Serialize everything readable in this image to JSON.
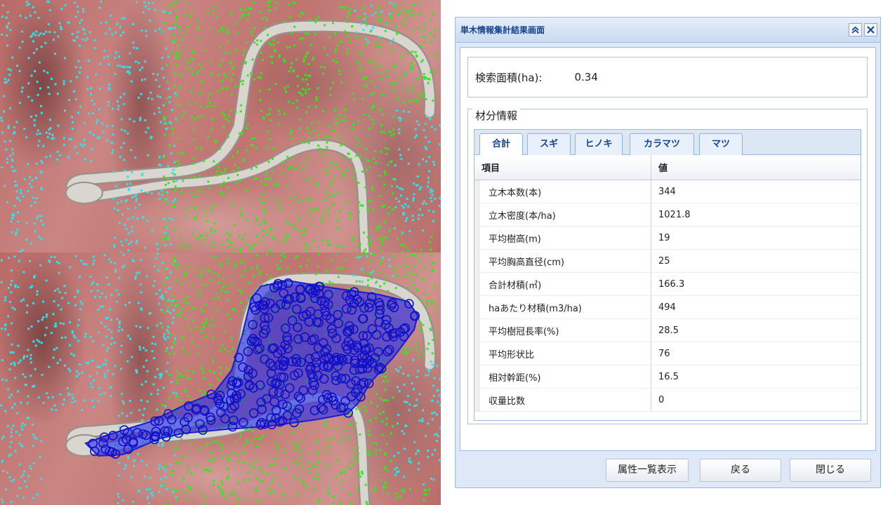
{
  "dialog": {
    "title": "単木情報集計結果画面",
    "collapse_icon": "double-chevron-up-icon",
    "close_icon": "close-icon",
    "search_area": {
      "label": "検索面積(ha):",
      "value": "0.34"
    },
    "material_info": {
      "legend": "材分情報",
      "tabs": [
        {
          "label": "合計",
          "active": true
        },
        {
          "label": "スギ",
          "active": false
        },
        {
          "label": "ヒノキ",
          "active": false
        },
        {
          "label": "カラマツ",
          "active": false
        },
        {
          "label": "マツ",
          "active": false
        }
      ],
      "columns": [
        "項目",
        "値"
      ],
      "rows": [
        {
          "item": "立木本数(本)",
          "value": "344"
        },
        {
          "item": "立木密度(本/ha)",
          "value": "1021.8"
        },
        {
          "item": "平均樹高(m)",
          "value": "19"
        },
        {
          "item": "平均胸高直径(cm)",
          "value": "25"
        },
        {
          "item": "合計材積(㎥)",
          "value": "166.3"
        },
        {
          "item": "haあたり材積(m3/ha)",
          "value": "494"
        },
        {
          "item": "平均樹冠長率(%)",
          "value": "28.5"
        },
        {
          "item": "平均形状比",
          "value": "76"
        },
        {
          "item": "相対幹距(%)",
          "value": "16.5"
        },
        {
          "item": "収量比数",
          "value": "0"
        }
      ]
    },
    "buttons": {
      "attribute_list": "属性一覧表示",
      "back": "戻る",
      "close": "閉じる"
    }
  },
  "map": {
    "cyan_color": "#35e0ea",
    "green_color": "#33e81c",
    "selection_fill": "#2a2ef0",
    "selection_stroke": "#1a1ad0",
    "road_color": "#d9d6d0"
  }
}
